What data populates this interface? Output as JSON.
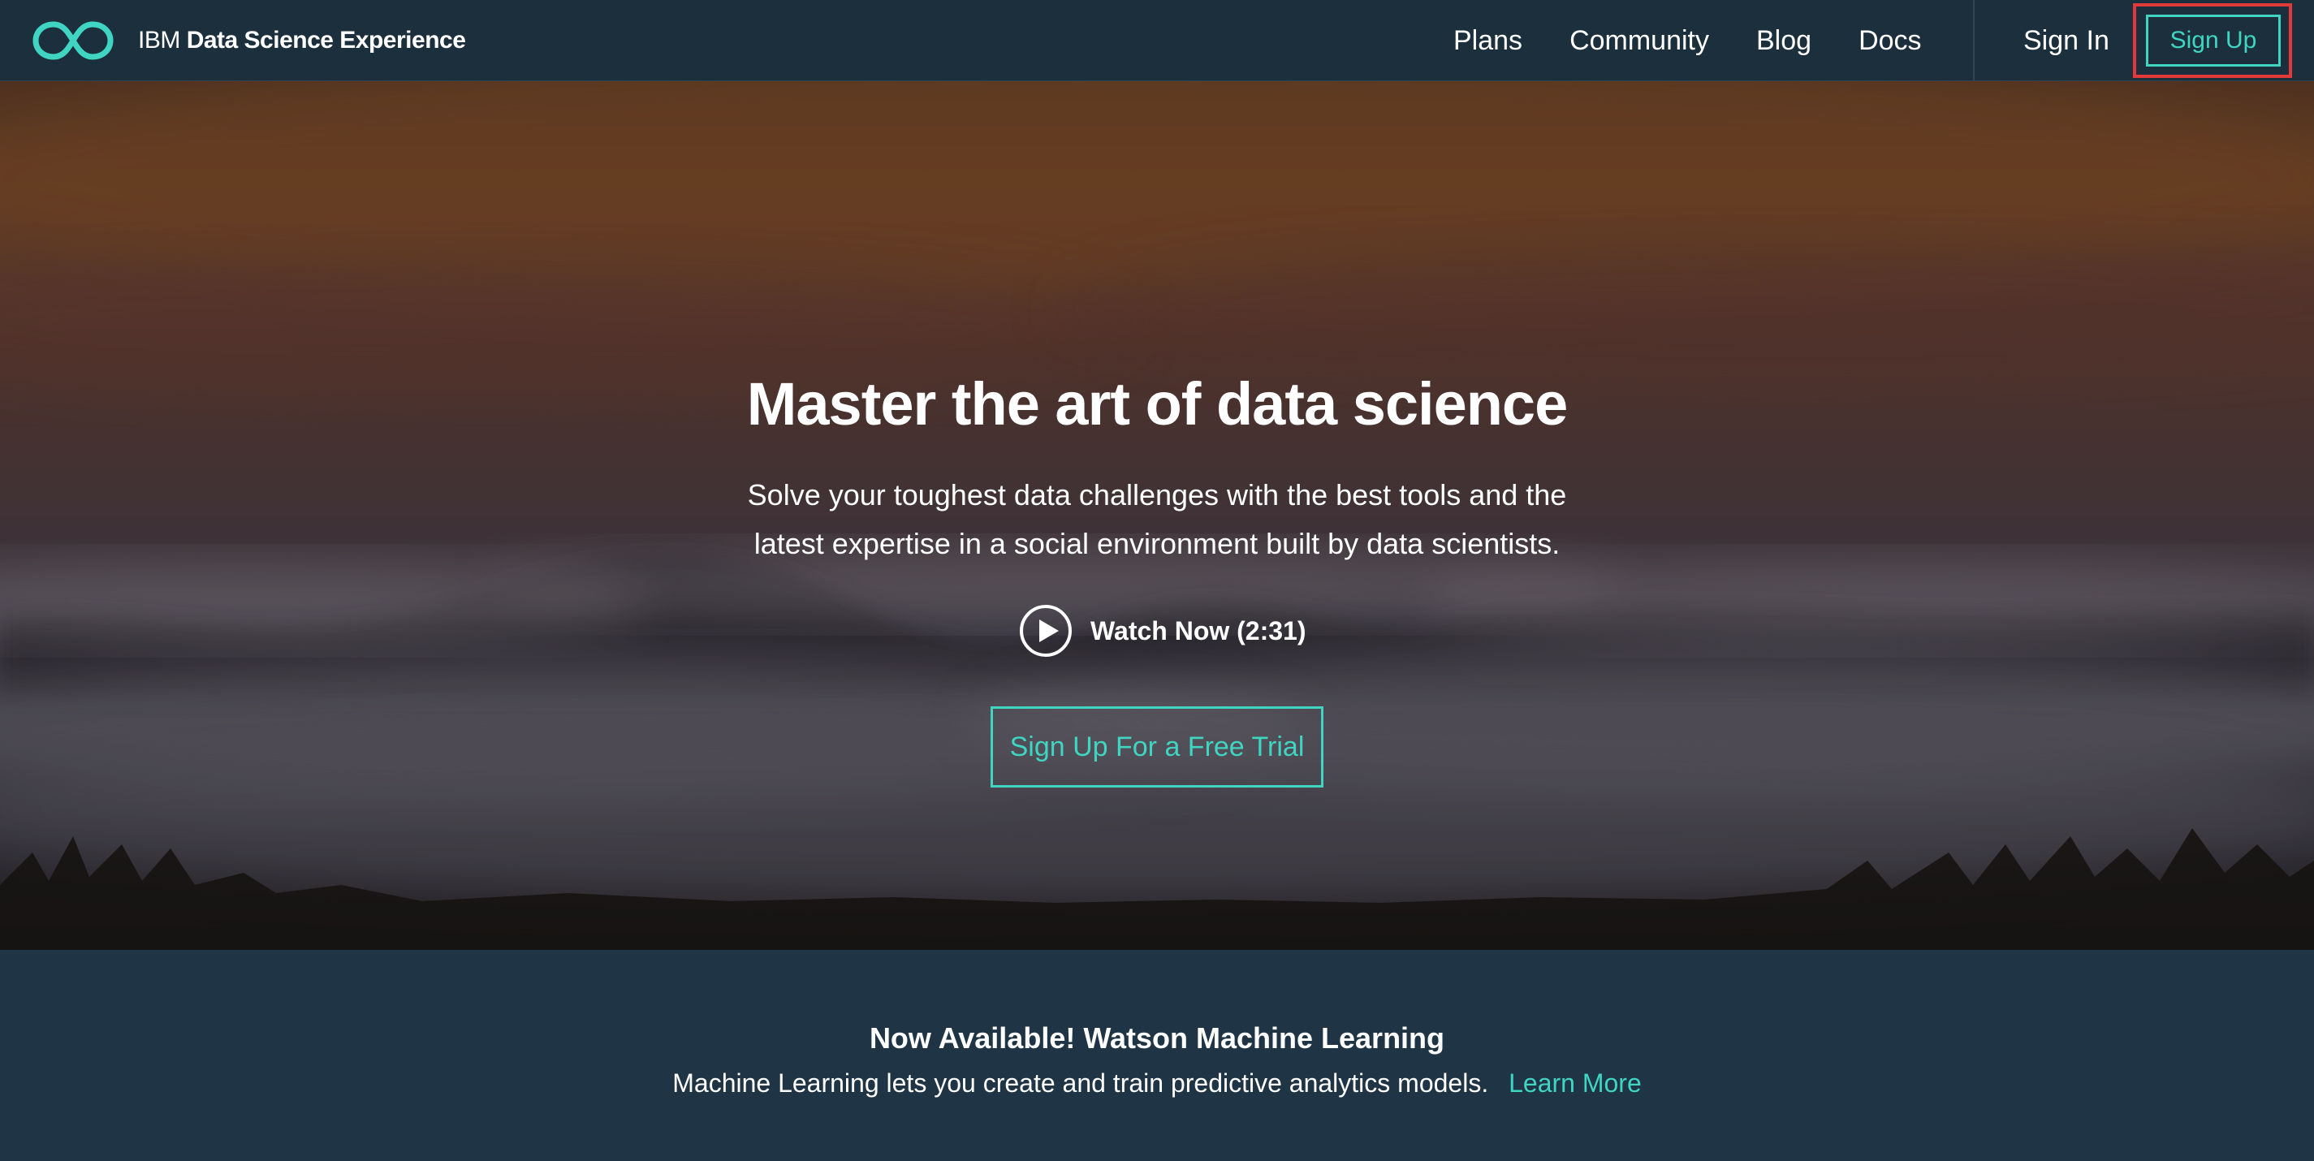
{
  "navbar": {
    "logo_icon": "infinity-icon",
    "brand_prefix": "IBM",
    "brand_name": "Data Science Experience",
    "links": [
      {
        "label": "Plans"
      },
      {
        "label": "Community"
      },
      {
        "label": "Blog"
      },
      {
        "label": "Docs"
      }
    ],
    "signin_label": "Sign In",
    "signup_label": "Sign Up"
  },
  "hero": {
    "title": "Master the art of data science",
    "subtitle": "Solve your toughest data challenges with the best tools and the latest expertise in a social environment built by data scientists.",
    "watch_label": "Watch Now (2:31)",
    "watch_icon": "play-icon",
    "cta_label": "Sign Up For a Free Trial"
  },
  "banner": {
    "title": "Now Available! Watson Machine Learning",
    "text": "Machine Learning lets you create and train predictive analytics models.",
    "link_label": "Learn More"
  },
  "colors": {
    "accent": "#3fd5c2",
    "navbar_bg": "#1c2f3c",
    "banner_bg": "#1f3444",
    "highlight": "#e23a3a"
  }
}
